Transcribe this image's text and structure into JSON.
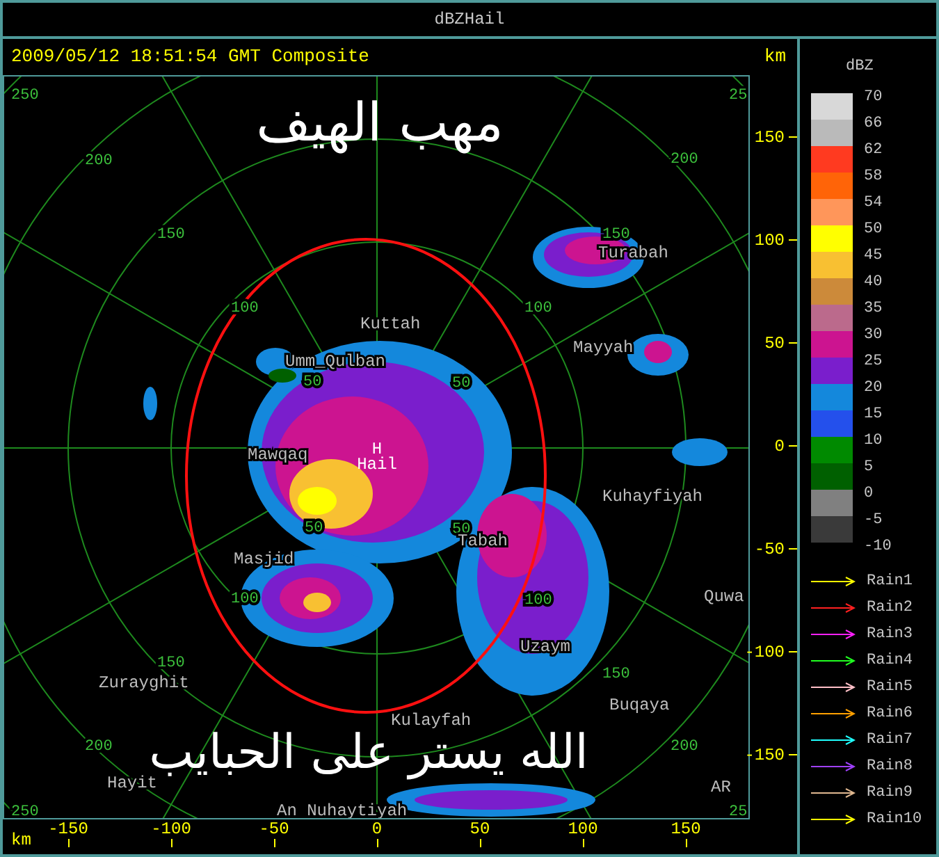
{
  "window": {
    "title": "dBZHail"
  },
  "header": {
    "timestamp": "2009/05/12 18:51:54 GMT Composite",
    "unit": "km"
  },
  "overlay_text": [
    "مهب الهيف",
    "الله يستر على الحبايب"
  ],
  "station": {
    "marker": "H",
    "name": "Hail"
  },
  "places": [
    "Kuttah",
    "Umm_Qulban",
    "Turabah",
    "Mayyah",
    "Mawqaq",
    "Masjid",
    "Tabah",
    "Kuhayfiyah",
    "Quwa",
    "Uzaym",
    "Buqaya",
    "Zurayghit",
    "Hayit",
    "Kulayfah",
    "An Nuhaytiyah",
    "AR"
  ],
  "ring_labels": [
    "250",
    "200",
    "150",
    "100",
    "50",
    "50",
    "100",
    "150",
    "200",
    "25",
    "50",
    "100",
    "150",
    "200",
    "250",
    "50",
    "100",
    "150",
    "200",
    "25"
  ],
  "y_axis": {
    "ticks": [
      "150",
      "100",
      "50",
      "0",
      "-50",
      "-100",
      "-150"
    ]
  },
  "x_axis": {
    "unit": "km",
    "ticks": [
      "-150",
      "-100",
      "-50",
      "0",
      "50",
      "100",
      "150"
    ]
  },
  "legend": {
    "title": "dBZ",
    "scale_labels": [
      "70",
      "66",
      "62",
      "58",
      "54",
      "50",
      "45",
      "40",
      "35",
      "30",
      "25",
      "20",
      "15",
      "10",
      "5",
      "0",
      "-5",
      "-10"
    ],
    "bands": [
      {
        "color": "#d8d8d8"
      },
      {
        "color": "#bababa"
      },
      {
        "color": "#ff3a20"
      },
      {
        "color": "#ff6408"
      },
      {
        "color": "#ff965a"
      },
      {
        "color": "#ffff00"
      },
      {
        "color": "#f8c032"
      },
      {
        "color": "#cc8a3a"
      },
      {
        "color": "#bb6a8c"
      },
      {
        "color": "#cc1490"
      },
      {
        "color": "#7a1ecc"
      },
      {
        "color": "#1488dc"
      },
      {
        "color": "#2450ec"
      },
      {
        "color": "#008a00"
      },
      {
        "color": "#006000"
      },
      {
        "color": "#808080"
      },
      {
        "color": "#3a3a3a"
      }
    ],
    "tracks": [
      {
        "label": "Rain1",
        "color": "#ffff00"
      },
      {
        "label": "Rain2",
        "color": "#ff2020"
      },
      {
        "label": "Rain3",
        "color": "#ff20ff"
      },
      {
        "label": "Rain4",
        "color": "#20ff20"
      },
      {
        "label": "Rain5",
        "color": "#ffc0c8"
      },
      {
        "label": "Rain6",
        "color": "#ffa000"
      },
      {
        "label": "Rain7",
        "color": "#20ffff"
      },
      {
        "label": "Rain8",
        "color": "#a040ff"
      },
      {
        "label": "Rain9",
        "color": "#e0b890"
      },
      {
        "label": "Rain10",
        "color": "#ffff00"
      }
    ]
  }
}
